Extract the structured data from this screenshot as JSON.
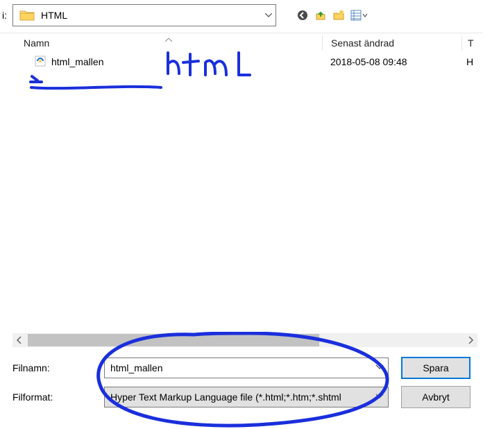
{
  "path_bar": {
    "label_left": "i:",
    "folder_name": "HTML"
  },
  "columns": {
    "name": "Namn",
    "modified": "Senast ändrad",
    "type_initial": "T"
  },
  "files": [
    {
      "name": "html_mallen",
      "modified": "2018-05-08 09:48",
      "type_initial": "H"
    }
  ],
  "form": {
    "filename_label": "Filnamn:",
    "filename_value": "html_mallen",
    "format_label": "Filformat:",
    "format_value": "Hyper Text Markup Language file (*.html;*.htm;*.shtml",
    "save": "Spara",
    "cancel": "Avbryt"
  },
  "annotations": {
    "handwritten_text": "html",
    "color": "#1a2fdc"
  }
}
